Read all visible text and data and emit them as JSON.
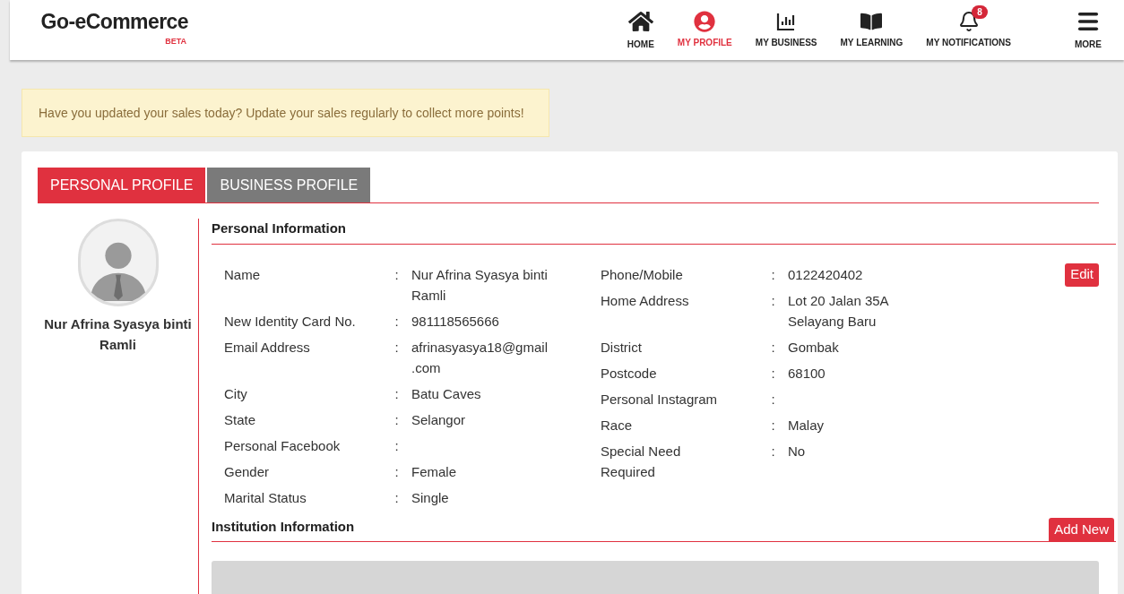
{
  "brand": {
    "name": "Go-eCommerce",
    "tag": "BETA"
  },
  "nav": [
    {
      "label": "HOME",
      "kind": "home",
      "selected": false
    },
    {
      "label": "MY PROFILE",
      "kind": "profile",
      "selected": true
    },
    {
      "label": "MY BUSINESS",
      "kind": "chart",
      "selected": false
    },
    {
      "label": "MY LEARNING",
      "kind": "book",
      "selected": false
    },
    {
      "label": "MY NOTIFICATIONS",
      "kind": "bell",
      "selected": false,
      "badge": "8"
    },
    {
      "label": "MORE",
      "kind": "menu",
      "selected": false
    }
  ],
  "notice": "Have you updated your sales today? Update your sales regularly to collect more points!",
  "tabs": [
    {
      "label": "PERSONAL PROFILE",
      "selected": true
    },
    {
      "label": "BUSINESS PROFILE",
      "selected": false
    }
  ],
  "profile_name": "Nur Afrina Syasya binti Ramli",
  "personal": {
    "title": "Personal Information",
    "edit": "Edit",
    "left": [
      {
        "label": "Name",
        "value": "Nur Afrina Syasya binti Ramli"
      },
      {
        "label": "New Identity Card No.",
        "value": "981118565666"
      },
      {
        "label": "Email Address",
        "value": "afrinasyasya18@gmail.com"
      },
      {
        "label": "City",
        "value": "Batu Caves"
      },
      {
        "label": "State",
        "value": "Selangor"
      },
      {
        "label": "Personal Facebook"
      },
      {
        "label": "Gender",
        "value": "Female"
      },
      {
        "label": "Marital Status",
        "value": "Single"
      }
    ],
    "right": [
      {
        "label": "Phone/Mobile",
        "value": "0122420402"
      },
      {
        "label": "Home Address",
        "value": "Lot 20 Jalan 35A Selayang Baru"
      },
      {
        "label": "District",
        "value": "Gombak"
      },
      {
        "label": "Postcode",
        "value": "68100"
      },
      {
        "label": "Personal Instagram"
      },
      {
        "label": "Race",
        "value": "Malay"
      },
      {
        "label": "Special Need Required",
        "value": "No"
      }
    ],
    "separator": ":"
  },
  "institution": {
    "title": "Institution Information",
    "add": "Add New"
  }
}
